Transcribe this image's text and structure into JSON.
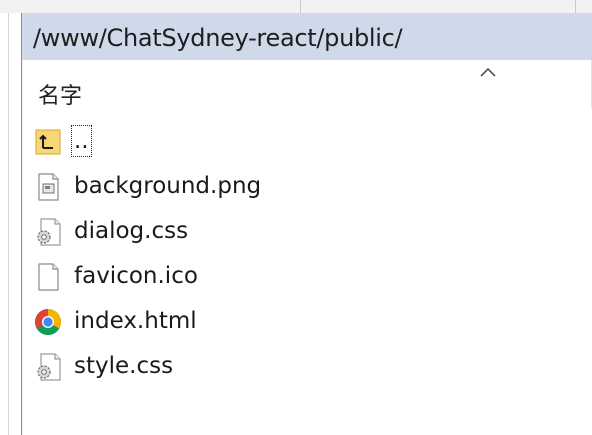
{
  "path_bar": {
    "path": "/www/ChatSydney-react/public/"
  },
  "file_list": {
    "column_name_label": "名字",
    "sort_direction": "ascending",
    "selection_color": "#cfd9ea",
    "items": [
      {
        "name": "..",
        "icon": "parent-folder-icon"
      },
      {
        "name": "background.png",
        "icon": "image-file-icon"
      },
      {
        "name": "dialog.css",
        "icon": "settings-file-icon"
      },
      {
        "name": "favicon.ico",
        "icon": "blank-file-icon"
      },
      {
        "name": "index.html",
        "icon": "chrome-icon"
      },
      {
        "name": "style.css",
        "icon": "settings-file-icon"
      }
    ]
  }
}
